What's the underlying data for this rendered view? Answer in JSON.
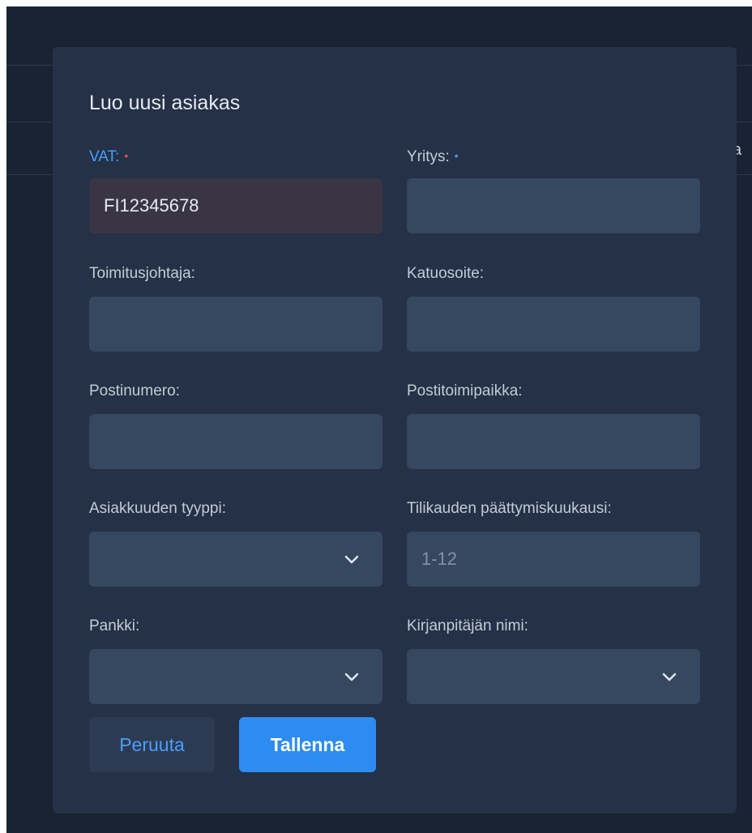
{
  "background": {
    "partial_text": "ka"
  },
  "modal": {
    "title": "Luo uusi asiakas",
    "fields": {
      "vat": {
        "label": "VAT:",
        "value": "FI12345678",
        "required_color": "#e05252"
      },
      "company": {
        "label": "Yritys:",
        "value": "",
        "required_color": "#4a9eff"
      },
      "ceo": {
        "label": "Toimitusjohtaja:",
        "value": ""
      },
      "street": {
        "label": "Katuosoite:",
        "value": ""
      },
      "postal_code": {
        "label": "Postinumero:",
        "value": ""
      },
      "city": {
        "label": "Postitoimipaikka:",
        "value": ""
      },
      "customer_type": {
        "label": "Asiakkuuden tyyppi:",
        "selected": ""
      },
      "fiscal_end_month": {
        "label": "Tilikauden päättymiskuukausi:",
        "placeholder": "1-12",
        "value": ""
      },
      "bank": {
        "label": "Pankki:",
        "selected": ""
      },
      "accountant": {
        "label": "Kirjanpitäjän nimi:",
        "selected": ""
      }
    },
    "buttons": {
      "cancel": "Peruuta",
      "save": "Tallenna"
    },
    "colors": {
      "accent": "#4a9eff",
      "primary_button": "#2d8cf0",
      "required_error": "#e05252"
    }
  }
}
